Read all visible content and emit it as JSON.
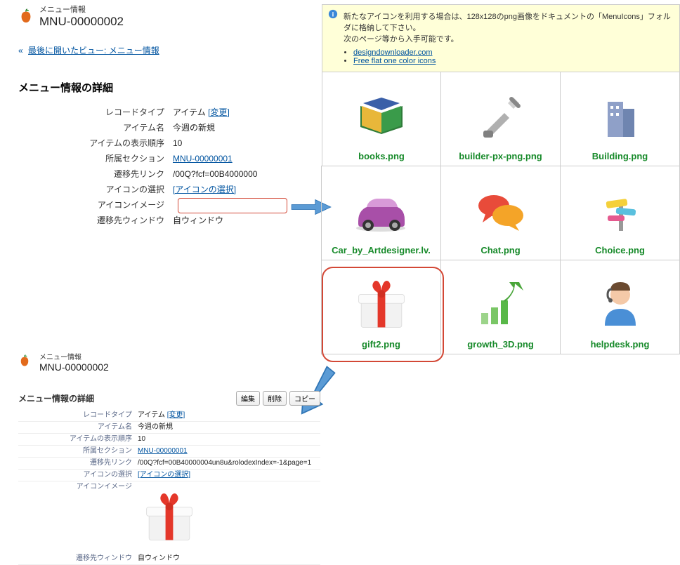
{
  "header": {
    "menu_info_label": "メニュー情報",
    "menu_id": "MNU-00000002"
  },
  "breadcrumb": {
    "prefix": "«",
    "text": "最後に開いたビュー: メニュー情報"
  },
  "section_title": "メニュー情報の詳細",
  "details": {
    "record_type_label": "レコードタイプ",
    "record_type_value": "アイテム",
    "record_type_change": "[変更]",
    "item_name_label": "アイテム名",
    "item_name_value": "今週の新規",
    "display_order_label": "アイテムの表示順序",
    "display_order_value": "10",
    "section_label": "所属セクション",
    "section_value": "MNU-00000001",
    "link_label": "遷移先リンク",
    "link_value": "/00Q?fcf=00B4000000",
    "icon_select_label": "アイコンの選択",
    "icon_select_value": "[アイコンの選択]",
    "icon_image_label": "アイコンイメージ",
    "window_label": "遷移先ウィンドウ",
    "window_value": "自ウィンドウ"
  },
  "info_box": {
    "line1": "新たなアイコンを利用する場合は、128x128のpng画像をドキュメントの「MenuIcons」フォルダに格納して下さい。",
    "line2": "次のページ等から入手可能です。",
    "link1": "designdownloader.com",
    "link2": "Free flat one color icons"
  },
  "icons": {
    "books": "books.png",
    "builder": "builder-px-png.png",
    "building": "Building.png",
    "car": "Car_by_Artdesigner.lv.",
    "chat": "Chat.png",
    "choice": "Choice.png",
    "gift": "gift2.png",
    "growth": "growth_3D.png",
    "helpdesk": "helpdesk.png"
  },
  "bottom": {
    "section_title": "メニュー情報の詳細",
    "btn_edit": "編集",
    "btn_delete": "削除",
    "btn_copy": "コピー",
    "record_type_label": "レコードタイプ",
    "record_type_value": "アイテム",
    "record_type_change": "[変更]",
    "item_name_label": "アイテム名",
    "item_name_value": "今週の新規",
    "display_order_label": "アイテムの表示順序",
    "display_order_value": "10",
    "section_label": "所属セクション",
    "section_value": "MNU-00000001",
    "link_label": "遷移先リンク",
    "link_value": "/00Q?fcf=00B40000004un8u&rolodexIndex=-1&page=1",
    "icon_select_label": "アイコンの選択",
    "icon_select_value": "[アイコンの選択]",
    "icon_image_label": "アイコンイメージ",
    "window_label": "遷移先ウィンドウ",
    "window_value": "自ウィンドウ"
  }
}
